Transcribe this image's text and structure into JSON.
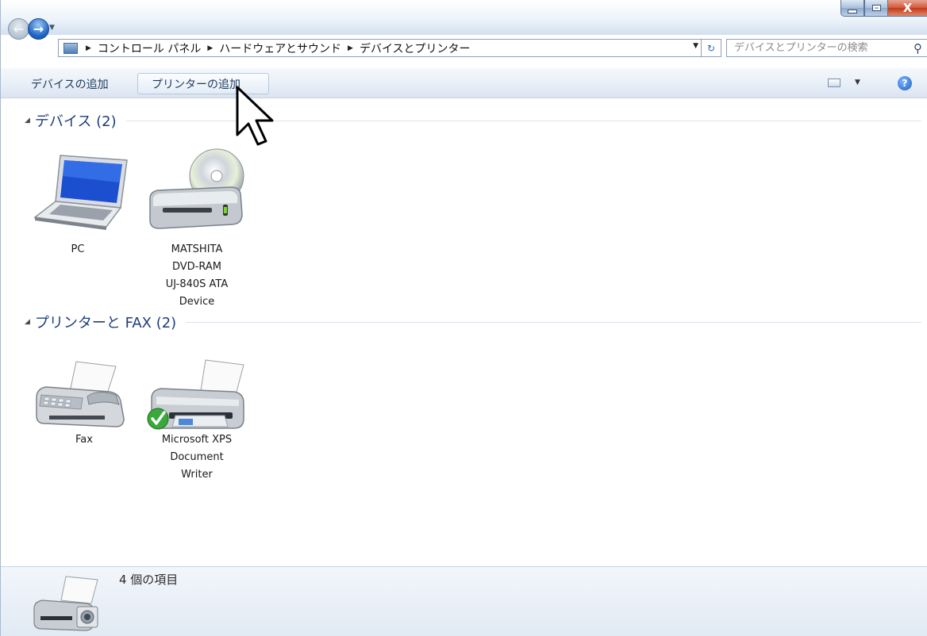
{
  "window": {
    "controls": {
      "minimize": "—",
      "maximize": "□",
      "close": "X"
    }
  },
  "nav": {
    "back_icon": "←",
    "forward_icon": "→"
  },
  "address": {
    "crumbs": [
      "コントロール パネル",
      "ハードウェアとサウンド",
      "デバイスとプリンター"
    ]
  },
  "search": {
    "placeholder": "デバイスとプリンターの検索"
  },
  "command_bar": {
    "add_device": "デバイスの追加",
    "add_printer": "プリンターの追加",
    "help_icon": "?"
  },
  "groups": [
    {
      "title": "デバイス (2)",
      "items": [
        {
          "label": "PC",
          "icon": "laptop-icon"
        },
        {
          "label": "MATSHITA DVD-RAM UJ-840S ATA Device",
          "label_lines": [
            "MATSHITA",
            "DVD-RAM",
            "UJ-840S ATA",
            "Device"
          ],
          "icon": "dvd-drive-icon"
        }
      ]
    },
    {
      "title": "プリンターと FAX (2)",
      "items": [
        {
          "label": "Fax",
          "icon": "fax-icon"
        },
        {
          "label": "Microsoft XPS Document Writer",
          "label_lines": [
            "Microsoft XPS",
            "Document",
            "Writer"
          ],
          "icon": "printer-icon",
          "default": true
        }
      ]
    }
  ],
  "details": {
    "count_text": "4 個の項目"
  }
}
